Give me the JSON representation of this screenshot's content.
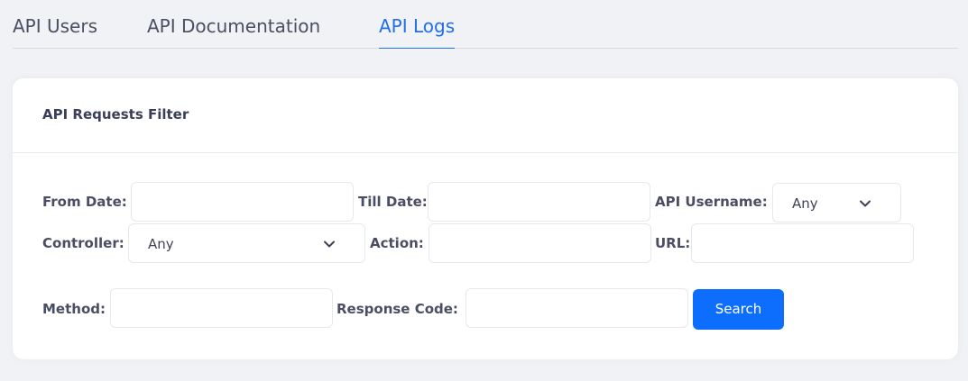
{
  "tabs": [
    {
      "label": "API Users"
    },
    {
      "label": "API Documentation"
    },
    {
      "label": "API Logs",
      "active": true
    }
  ],
  "filter": {
    "title": "API Requests Filter",
    "fields": {
      "from_date": {
        "label": "From Date:",
        "value": ""
      },
      "till_date": {
        "label": "Till Date:",
        "value": ""
      },
      "api_username": {
        "label": "API Username:",
        "selected": "Any"
      },
      "controller": {
        "label": "Controller:",
        "selected": "Any"
      },
      "action": {
        "label": "Action:",
        "value": ""
      },
      "url": {
        "label": "URL:",
        "value": ""
      },
      "method": {
        "label": "Method:",
        "value": ""
      },
      "response_code": {
        "label": "Response Code:",
        "value": ""
      }
    },
    "search_label": "Search"
  },
  "icons": {
    "select_arrow": "chevron-down-icon"
  },
  "colors": {
    "accent": "#0d6efd",
    "active_tab": "#1f6feb",
    "page_background": "#f1f2f5"
  }
}
